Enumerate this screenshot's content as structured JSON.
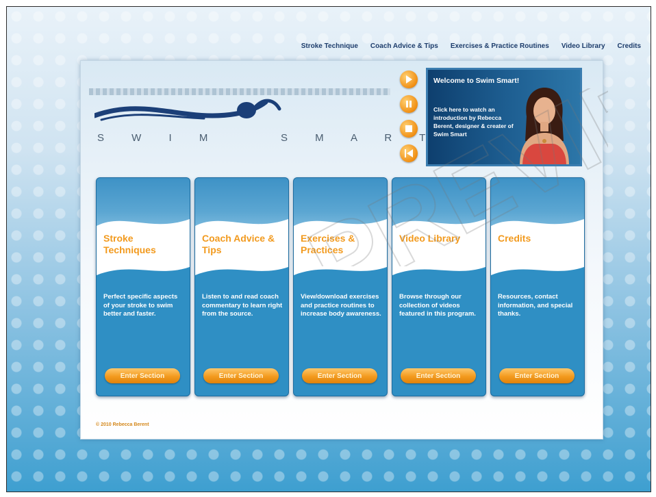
{
  "nav": {
    "items": [
      {
        "label": "Stroke Technique"
      },
      {
        "label": "Coach Advice & Tips"
      },
      {
        "label": "Exercises & Practice Routines"
      },
      {
        "label": "Video Library"
      },
      {
        "label": "Credits"
      }
    ]
  },
  "logo": {
    "text": "S W I M    S M A R T"
  },
  "video": {
    "title": "Welcome to Swim Smart!",
    "description": "Click here to watch an introduction by Rebecca Berent, designer & creater of Swim Smart",
    "controls": [
      "play-icon",
      "pause-icon",
      "stop-icon",
      "rewind-icon"
    ]
  },
  "cards": [
    {
      "title": "Stroke Techniques",
      "description": "Perfect specific aspects of your stroke to swim better and faster.",
      "button": "Enter Section"
    },
    {
      "title": "Coach Advice & Tips",
      "description": "Listen to and read coach commentary to learn right from the source.",
      "button": "Enter Section"
    },
    {
      "title": "Exercises & Practices",
      "description": "View/download exercises and practice routines to increase body awareness.",
      "button": "Enter Section"
    },
    {
      "title": "Video Library",
      "description": "Browse through our collection of videos featured in this program.",
      "button": "Enter Section"
    },
    {
      "title": "Credits",
      "description": "Resources, contact information, and special thanks.",
      "button": "Enter Section"
    }
  ],
  "footer": {
    "copyright": "© 2010 Rebecca Berent"
  },
  "watermark": {
    "text": "PREVIEW"
  },
  "colors": {
    "accent": "#f29a1e",
    "card_blue": "#2f8fc4",
    "nav": "#1d3c6b"
  }
}
